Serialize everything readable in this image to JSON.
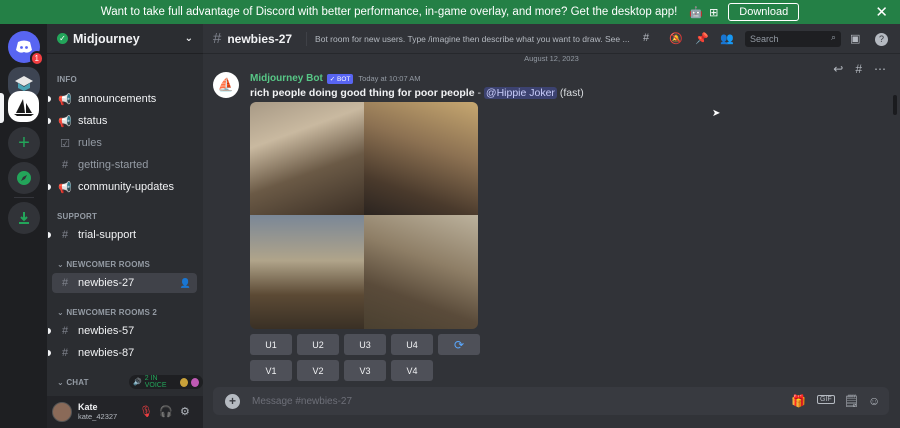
{
  "banner": {
    "text": "Want to take full advantage of Discord with better performance, in-game overlay, and more? Get the desktop app!",
    "os_icons": [
      "apple-icon",
      "android-icon",
      "windows-icon"
    ],
    "download_label": "Download",
    "close_icon": "✕"
  },
  "rail": {
    "home_badge": "1",
    "items": [
      "discord-home-icon",
      "server-icon",
      "midjourney-server-icon",
      "add-server-icon",
      "explore-icon",
      "download-apps-icon"
    ]
  },
  "server": {
    "name": "Midjourney"
  },
  "sidebar": {
    "categories": {
      "info": "INFO",
      "support": "SUPPORT",
      "newcomer": "NEWCOMER ROOMS",
      "newcomer2": "NEWCOMER ROOMS 2",
      "chat": "CHAT"
    },
    "channels": {
      "announcements": "announcements",
      "status": "status",
      "rules": "rules",
      "getting_started": "getting-started",
      "community_updates": "community-updates",
      "trial_support": "trial-support",
      "newbies27": "newbies-27",
      "newbies57": "newbies-57",
      "newbies87": "newbies-87"
    },
    "voice_badge": "2 IN VOICE"
  },
  "user": {
    "name": "Kate",
    "tag": "kate_42327"
  },
  "header": {
    "channel": "newbies-27",
    "topic": "Bot room for new users. Type /imagine then describe what you want to draw. See ...",
    "search_placeholder": "Search"
  },
  "chat": {
    "date_divider": "August 12, 2023",
    "author": "Midjourney Bot",
    "bot_tag": "✓ BOT",
    "timestamp": "Today at 10:07 AM",
    "prompt": "rich people doing good thing for poor people",
    "dash": " - ",
    "mention": "@Hippie Joker",
    "speed": " (fast)",
    "buttons_row1": [
      "U1",
      "U2",
      "U3",
      "U4"
    ],
    "buttons_row2": [
      "V1",
      "V2",
      "V3",
      "V4"
    ],
    "reroll_icon": "⟳"
  },
  "composer": {
    "placeholder": "Message #newbies-27"
  },
  "colors": {
    "banner": "#248046",
    "accent": "#5865f2",
    "bot_name": "#57c786",
    "online": "#23a55a"
  }
}
